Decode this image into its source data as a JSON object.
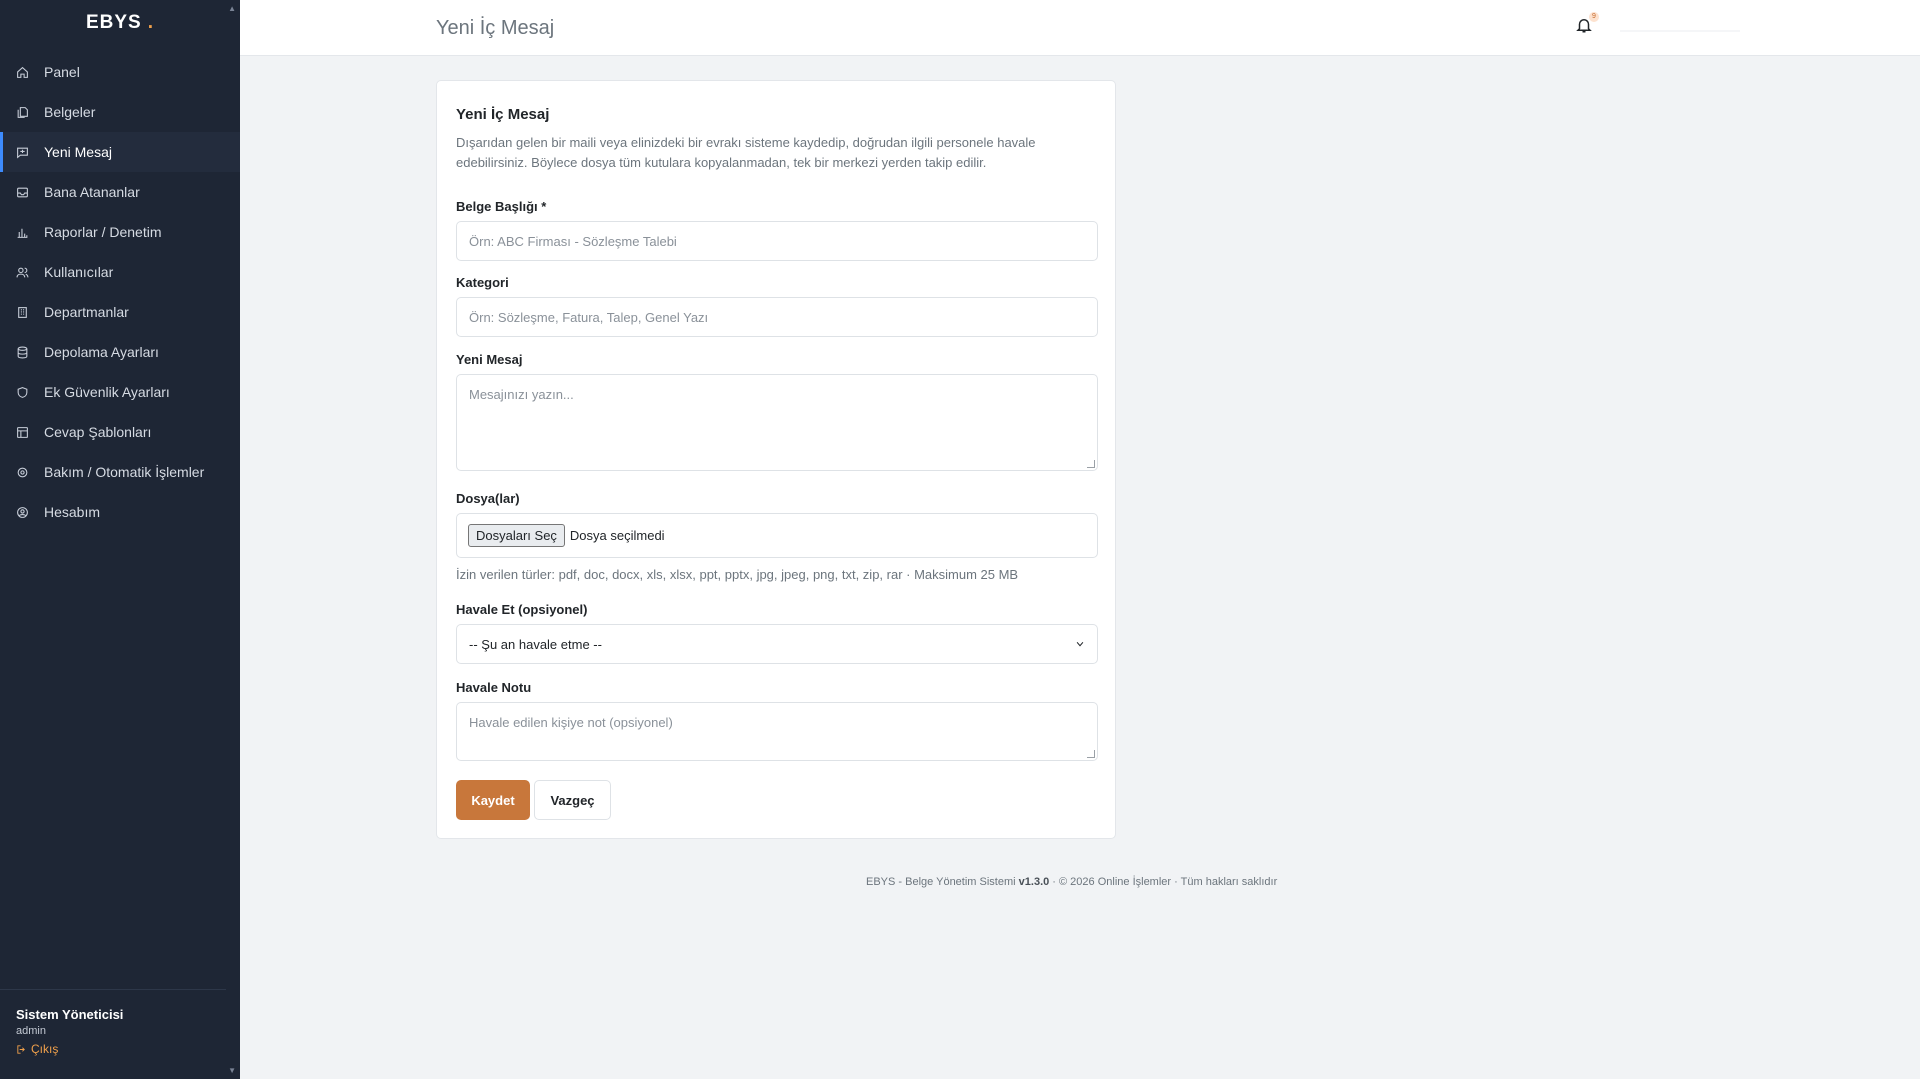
{
  "sidebar": {
    "brand": "EBYS",
    "brand_dot": ".",
    "items": [
      {
        "label": "Panel",
        "icon": "home-icon"
      },
      {
        "label": "Belgeler",
        "icon": "documents-icon"
      },
      {
        "label": "Yeni Mesaj",
        "icon": "message-plus-icon",
        "active": true
      },
      {
        "label": "Bana Atananlar",
        "icon": "inbox-icon"
      },
      {
        "label": "Raporlar / Denetim",
        "icon": "bar-chart-icon"
      },
      {
        "label": "Kullanıcılar",
        "icon": "users-icon"
      },
      {
        "label": "Departmanlar",
        "icon": "building-icon"
      },
      {
        "label": "Depolama Ayarları",
        "icon": "database-icon"
      },
      {
        "label": "Ek Güvenlik Ayarları",
        "icon": "shield-icon"
      },
      {
        "label": "Cevap Şablonları",
        "icon": "template-icon"
      },
      {
        "label": "Bakım / Otomatik İşlemler",
        "icon": "gear-icon"
      },
      {
        "label": "Hesabım",
        "icon": "user-circle-icon"
      }
    ],
    "user_name": "Sistem Yöneticisi",
    "user_role": "admin",
    "logout_label": "Çıkış"
  },
  "header": {
    "title": "Yeni İç Mesaj",
    "notification_count": "9"
  },
  "form": {
    "title": "Yeni İç Mesaj",
    "description": "Dışarıdan gelen bir maili veya elinizdeki bir evrakı sisteme kaydedip, doğrudan ilgili personele havale edebilirsiniz. Böylece dosya tüm kutulara kopyalanmadan, tek bir merkezi yerden takip edilir.",
    "doc_title_label": "Belge Başlığı *",
    "doc_title_placeholder": "Örn: ABC Firması - Sözleşme Talebi",
    "category_label": "Kategori",
    "category_placeholder": "Örn: Sözleşme, Fatura, Talep, Genel Yazı",
    "message_label": "Yeni Mesaj",
    "message_placeholder": "Mesajınızı yazın...",
    "files_label": "Dosya(lar)",
    "file_button": "Dosyaları Seç",
    "file_status": "Dosya seçilmedi",
    "files_hint": "İzin verilen türler: pdf, doc, docx, xls, xlsx, ppt, pptx, jpg, jpeg, png, txt, zip, rar · Maksimum 25 MB",
    "forward_label": "Havale Et (opsiyonel)",
    "forward_selected": "-- Şu an havale etme --",
    "forward_note_label": "Havale Notu",
    "forward_note_placeholder": "Havale edilen kişiye not (opsiyonel)",
    "save_label": "Kaydet",
    "cancel_label": "Vazgeç"
  },
  "footer": {
    "text_before": "EBYS - Belge Yönetim Sistemi ",
    "version": "v1.3.0",
    "text_after": " · © 2026 Online İşlemler · Tüm hakları saklıdır"
  },
  "colors": {
    "sidebar_bg": "#1e2635",
    "accent": "#c8773b",
    "active_indicator": "#3d8bfd"
  }
}
